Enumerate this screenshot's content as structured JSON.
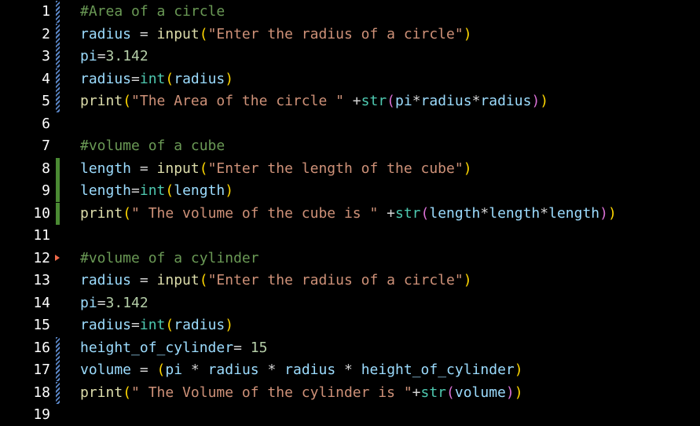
{
  "editor": {
    "lines": [
      {
        "n": "1",
        "marker": "modified",
        "parts": [
          {
            "t": "#Area of a circle",
            "c": "cm"
          }
        ]
      },
      {
        "n": "2",
        "marker": "modified",
        "parts": [
          {
            "t": "radius",
            "c": "vr"
          },
          {
            "t": " = ",
            "c": "op"
          },
          {
            "t": "input",
            "c": "fn"
          },
          {
            "t": "(",
            "c": "p1"
          },
          {
            "t": "\"Enter the radius of a circle\"",
            "c": "st"
          },
          {
            "t": ")",
            "c": "p1"
          }
        ]
      },
      {
        "n": "3",
        "marker": "modified",
        "parts": [
          {
            "t": "pi",
            "c": "vr"
          },
          {
            "t": "=",
            "c": "op"
          },
          {
            "t": "3.142",
            "c": "nm"
          }
        ]
      },
      {
        "n": "4",
        "marker": "modified",
        "parts": [
          {
            "t": "radius",
            "c": "vr"
          },
          {
            "t": "=",
            "c": "op"
          },
          {
            "t": "int",
            "c": "bi"
          },
          {
            "t": "(",
            "c": "p1"
          },
          {
            "t": "radius",
            "c": "vr"
          },
          {
            "t": ")",
            "c": "p1"
          }
        ]
      },
      {
        "n": "5",
        "marker": "modified",
        "parts": [
          {
            "t": "print",
            "c": "fn"
          },
          {
            "t": "(",
            "c": "p1"
          },
          {
            "t": "\"The Area of the circle \"",
            "c": "st"
          },
          {
            "t": " +",
            "c": "op"
          },
          {
            "t": "str",
            "c": "bi"
          },
          {
            "t": "(",
            "c": "p2"
          },
          {
            "t": "pi",
            "c": "vr"
          },
          {
            "t": "*",
            "c": "op"
          },
          {
            "t": "radius",
            "c": "vr"
          },
          {
            "t": "*",
            "c": "op"
          },
          {
            "t": "radius",
            "c": "vr"
          },
          {
            "t": ")",
            "c": "p2"
          },
          {
            "t": ")",
            "c": "p1"
          }
        ]
      },
      {
        "n": "6",
        "marker": "",
        "parts": []
      },
      {
        "n": "7",
        "marker": "",
        "parts": [
          {
            "t": "#volume of a cube",
            "c": "cm"
          }
        ]
      },
      {
        "n": "8",
        "marker": "added",
        "parts": [
          {
            "t": "length",
            "c": "vr"
          },
          {
            "t": " = ",
            "c": "op"
          },
          {
            "t": "input",
            "c": "fn"
          },
          {
            "t": "(",
            "c": "p1"
          },
          {
            "t": "\"Enter the length of the cube\"",
            "c": "st"
          },
          {
            "t": ")",
            "c": "p1"
          }
        ]
      },
      {
        "n": "9",
        "marker": "added",
        "parts": [
          {
            "t": "length",
            "c": "vr"
          },
          {
            "t": "=",
            "c": "op"
          },
          {
            "t": "int",
            "c": "bi"
          },
          {
            "t": "(",
            "c": "p1"
          },
          {
            "t": "length",
            "c": "vr"
          },
          {
            "t": ")",
            "c": "p1"
          }
        ]
      },
      {
        "n": "10",
        "marker": "added",
        "parts": [
          {
            "t": "print",
            "c": "fn"
          },
          {
            "t": "(",
            "c": "p1"
          },
          {
            "t": "\" The volume of the cube is \"",
            "c": "st"
          },
          {
            "t": " +",
            "c": "op"
          },
          {
            "t": "str",
            "c": "bi"
          },
          {
            "t": "(",
            "c": "p2"
          },
          {
            "t": "length",
            "c": "vr"
          },
          {
            "t": "*",
            "c": "op"
          },
          {
            "t": "length",
            "c": "vr"
          },
          {
            "t": "*",
            "c": "op"
          },
          {
            "t": "length",
            "c": "vr"
          },
          {
            "t": ")",
            "c": "p2"
          },
          {
            "t": ")",
            "c": "p1"
          }
        ]
      },
      {
        "n": "11",
        "marker": "",
        "parts": []
      },
      {
        "n": "12",
        "marker": "deleted",
        "parts": [
          {
            "t": "#volume of a cylinder",
            "c": "cm"
          }
        ]
      },
      {
        "n": "13",
        "marker": "",
        "parts": [
          {
            "t": "radius",
            "c": "vr"
          },
          {
            "t": " = ",
            "c": "op"
          },
          {
            "t": "input",
            "c": "fn"
          },
          {
            "t": "(",
            "c": "p1"
          },
          {
            "t": "\"Enter the radius of a circle\"",
            "c": "st"
          },
          {
            "t": ")",
            "c": "p1"
          }
        ]
      },
      {
        "n": "14",
        "marker": "",
        "parts": [
          {
            "t": "pi",
            "c": "vr"
          },
          {
            "t": "=",
            "c": "op"
          },
          {
            "t": "3.142",
            "c": "nm"
          }
        ]
      },
      {
        "n": "15",
        "marker": "",
        "parts": [
          {
            "t": "radius",
            "c": "vr"
          },
          {
            "t": "=",
            "c": "op"
          },
          {
            "t": "int",
            "c": "bi"
          },
          {
            "t": "(",
            "c": "p1"
          },
          {
            "t": "radius",
            "c": "vr"
          },
          {
            "t": ")",
            "c": "p1"
          }
        ]
      },
      {
        "n": "16",
        "marker": "modified",
        "parts": [
          {
            "t": "height_of_cylinder",
            "c": "vr"
          },
          {
            "t": "= ",
            "c": "op"
          },
          {
            "t": "15",
            "c": "nm"
          }
        ]
      },
      {
        "n": "17",
        "marker": "modified",
        "parts": [
          {
            "t": "volume",
            "c": "vr"
          },
          {
            "t": " = ",
            "c": "op"
          },
          {
            "t": "(",
            "c": "p1"
          },
          {
            "t": "pi",
            "c": "vr"
          },
          {
            "t": " * ",
            "c": "op"
          },
          {
            "t": "radius",
            "c": "vr"
          },
          {
            "t": " * ",
            "c": "op"
          },
          {
            "t": "radius",
            "c": "vr"
          },
          {
            "t": " * ",
            "c": "op"
          },
          {
            "t": "height_of_cylinder",
            "c": "vr"
          },
          {
            "t": ")",
            "c": "p1"
          }
        ]
      },
      {
        "n": "18",
        "marker": "modified",
        "parts": [
          {
            "t": "print",
            "c": "fn"
          },
          {
            "t": "(",
            "c": "p1"
          },
          {
            "t": "\" The Volume of the cylinder is \"",
            "c": "st"
          },
          {
            "t": "+",
            "c": "op"
          },
          {
            "t": "str",
            "c": "bi"
          },
          {
            "t": "(",
            "c": "p2"
          },
          {
            "t": "volume",
            "c": "vr"
          },
          {
            "t": ")",
            "c": "p2"
          },
          {
            "t": ")",
            "c": "p1"
          }
        ]
      },
      {
        "n": "19",
        "marker": "",
        "parts": []
      }
    ]
  },
  "colors": {
    "background": "#000000",
    "line_number": "#ffffff",
    "comment": "#6a9955",
    "variable": "#9cdcfe",
    "function": "#dcdcaa",
    "string": "#ce9178",
    "number": "#b5cea8",
    "builtin": "#4ec9b0",
    "bracket_level_1": "#ffd700",
    "bracket_level_2": "#da70d6",
    "gutter_modified": "#5c88c9",
    "gutter_added": "#4a8a33",
    "gutter_deleted": "#f06a4a"
  }
}
